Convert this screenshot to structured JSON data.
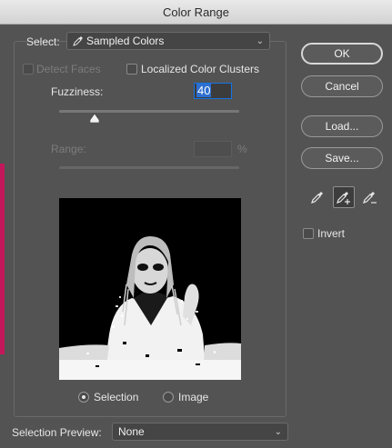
{
  "window": {
    "title": "Color Range"
  },
  "select": {
    "label": "Select:",
    "value": "Sampled Colors"
  },
  "detect_faces": {
    "label": "Detect Faces",
    "checked": false,
    "enabled": false
  },
  "localized_clusters": {
    "label": "Localized Color Clusters",
    "checked": false
  },
  "fuzziness": {
    "label": "Fuzziness:",
    "value": "40",
    "slider_fraction": 0.2
  },
  "range": {
    "label": "Range:",
    "value": "",
    "unit": "%",
    "enabled": false
  },
  "preview_mode": {
    "options": [
      {
        "label": "Selection",
        "selected": true
      },
      {
        "label": "Image",
        "selected": false
      }
    ]
  },
  "selection_preview": {
    "label": "Selection Preview:",
    "value": "None"
  },
  "buttons": {
    "ok": "OK",
    "cancel": "Cancel",
    "load": "Load...",
    "save": "Save..."
  },
  "tools": [
    {
      "icon": "eyedropper-icon",
      "active": false
    },
    {
      "icon": "eyedropper-plus-icon",
      "active": true
    },
    {
      "icon": "eyedropper-minus-icon",
      "active": false
    }
  ],
  "invert": {
    "label": "Invert",
    "checked": false
  },
  "colors": {
    "accent": "#1473e6",
    "background": "#535353",
    "highlight_strip": "#c2185b"
  }
}
